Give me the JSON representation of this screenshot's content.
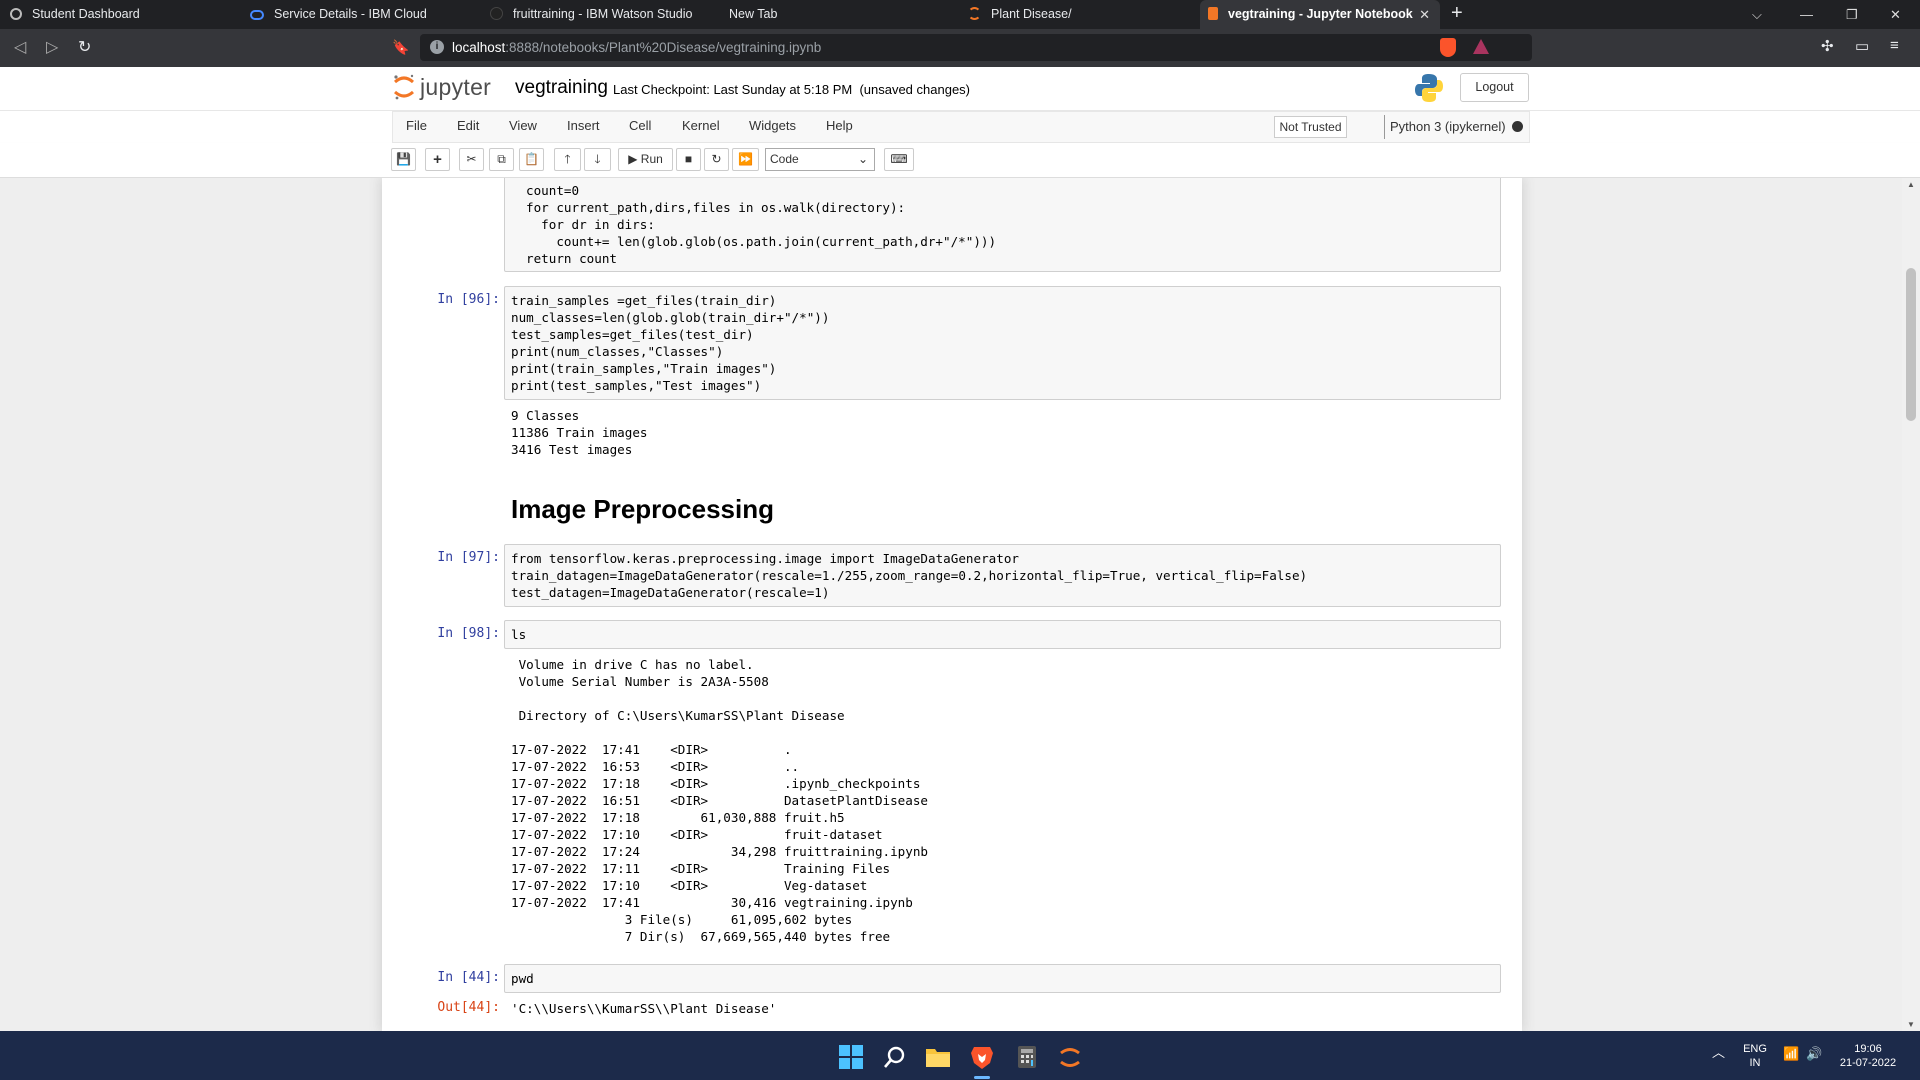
{
  "browser": {
    "tabs": [
      {
        "label": "Student Dashboard",
        "active": false
      },
      {
        "label": "Service Details - IBM Cloud",
        "active": false
      },
      {
        "label": "fruittraining - IBM Watson Studio",
        "active": false
      },
      {
        "label": "New Tab",
        "active": false
      },
      {
        "label": "Plant Disease/",
        "active": false
      },
      {
        "label": "vegtraining - Jupyter Notebook",
        "active": true
      }
    ],
    "url_host": "localhost",
    "url_path": ":8888/notebooks/Plant%20Disease/vegtraining.ipynb"
  },
  "jupyter": {
    "logo_text": "jupyter",
    "notebook_name": "vegtraining",
    "checkpoint": "Last Checkpoint: Last Sunday at 5:18 PM",
    "unsaved": "(unsaved changes)",
    "logout_label": "Logout",
    "menu": [
      "File",
      "Edit",
      "View",
      "Insert",
      "Cell",
      "Kernel",
      "Widgets",
      "Help"
    ],
    "trusted_label": "Not Trusted",
    "kernel_label": "Python 3 (ipykernel)",
    "run_label": "Run",
    "cell_type": "Code"
  },
  "cells": {
    "c0_lines": [
      "count=0",
      "for current_path,dirs,files in os.walk(directory):",
      "  for dr in dirs:",
      "    count+= len(glob.glob(os.path.join(current_path,dr+\"/*\")))",
      "return count"
    ],
    "c1_prompt": "In [96]:",
    "c1_lines": [
      "train_samples =get_files(train_dir)",
      "num_classes=len(glob.glob(train_dir+\"/*\"))",
      "test_samples=get_files(test_dir)",
      "print(num_classes,\"Classes\")",
      "print(train_samples,\"Train images\")",
      "print(test_samples,\"Test images\")"
    ],
    "c1_output": "9 Classes\n11386 Train images\n3416 Test images",
    "heading": "Image Preprocessing",
    "c2_prompt": "In [97]:",
    "c2_lines": [
      "from tensorflow.keras.preprocessing.image import ImageDataGenerator",
      "train_datagen=ImageDataGenerator(rescale=1./255,zoom_range=0.2,horizontal_flip=True, vertical_flip=False)",
      "test_datagen=ImageDataGenerator(rescale=1)"
    ],
    "c3_prompt": "In [98]:",
    "c3_code": "ls",
    "c3_output": " Volume in drive C has no label.\n Volume Serial Number is 2A3A-5508\n\n Directory of C:\\Users\\KumarSS\\Plant Disease\n\n17-07-2022  17:41    <DIR>          .\n17-07-2022  16:53    <DIR>          ..\n17-07-2022  17:18    <DIR>          .ipynb_checkpoints\n17-07-2022  16:51    <DIR>          DatasetPlantDisease\n17-07-2022  17:18        61,030,888 fruit.h5\n17-07-2022  17:10    <DIR>          fruit-dataset\n17-07-2022  17:24            34,298 fruittraining.ipynb\n17-07-2022  17:11    <DIR>          Training Files\n17-07-2022  17:10    <DIR>          Veg-dataset\n17-07-2022  17:41            30,416 vegtraining.ipynb\n               3 File(s)     61,095,602 bytes\n               7 Dir(s)  67,669,565,440 bytes free",
    "c4_prompt": "In [44]:",
    "c4_code": "pwd",
    "c4_out_prompt": "Out[44]:",
    "c4_output": "'C:\\\\Users\\\\KumarSS\\\\Plant Disease'"
  },
  "taskbar": {
    "lang_line1": "ENG",
    "lang_line2": "IN",
    "time": "19:06",
    "date": "21-07-2022"
  },
  "colors": {
    "prompt_in": "#303f9f",
    "prompt_out": "#d84315",
    "keyword": "#008000",
    "string": "#ba2121",
    "operator": "#aa22ff"
  }
}
